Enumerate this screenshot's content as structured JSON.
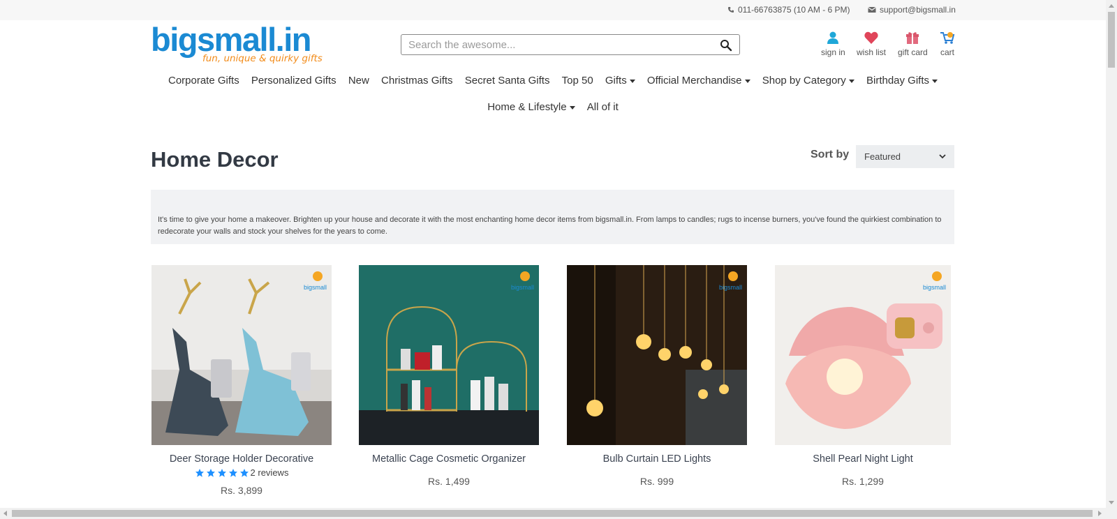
{
  "topbar": {
    "phone": "011-66763875 (10 AM - 6 PM)",
    "email": "support@bigsmall.in"
  },
  "header": {
    "logo_text": "bigsmall.in",
    "logo_tagline": "fun, unique & quirky gifts",
    "search_placeholder": "Search the awesome...",
    "links": [
      {
        "label": "sign in",
        "icon": "user-icon"
      },
      {
        "label": "wish list",
        "icon": "heart-icon"
      },
      {
        "label": "gift card",
        "icon": "gift-icon"
      },
      {
        "label": "cart",
        "icon": "cart-icon"
      }
    ]
  },
  "nav": {
    "row1": [
      {
        "label": "Corporate Gifts",
        "dropdown": false
      },
      {
        "label": "Personalized Gifts",
        "dropdown": false
      },
      {
        "label": "New",
        "dropdown": false
      },
      {
        "label": "Christmas Gifts",
        "dropdown": false
      },
      {
        "label": "Secret Santa Gifts",
        "dropdown": false
      },
      {
        "label": "Top 50",
        "dropdown": false
      },
      {
        "label": "Gifts",
        "dropdown": true
      },
      {
        "label": "Official Merchandise",
        "dropdown": true
      },
      {
        "label": "Shop by Category",
        "dropdown": true
      },
      {
        "label": "Birthday Gifts",
        "dropdown": true
      }
    ],
    "row2": [
      {
        "label": "Home & Lifestyle",
        "dropdown": true
      },
      {
        "label": "All of it",
        "dropdown": false
      }
    ]
  },
  "collection": {
    "title": "Home Decor",
    "sort_label": "Sort by",
    "sort_value": "Featured",
    "description": "It's time to give your home a makeover. Brighten up your house and decorate it with the most enchanting home decor items from bigsmall.in. From lamps to candles; rugs to incense burners, you've found the quirkiest combination to redecorate your walls and stock your shelves for the years to come."
  },
  "products": [
    {
      "name": "Deer Storage Holder Decorative",
      "price": "Rs. 3,899",
      "reviews": "2 reviews",
      "stars": 5
    },
    {
      "name": "Metallic Cage Cosmetic Organizer",
      "price": "Rs. 1,499"
    },
    {
      "name": "Bulb Curtain LED Lights",
      "price": "Rs. 999"
    },
    {
      "name": "Shell Pearl Night Light",
      "price": "Rs. 1,299"
    }
  ],
  "colors": {
    "brand_blue": "#1b8ad3",
    "brand_orange": "#f28c1b",
    "star_blue": "#1e90ff",
    "wishlist_red": "#e0455a"
  }
}
